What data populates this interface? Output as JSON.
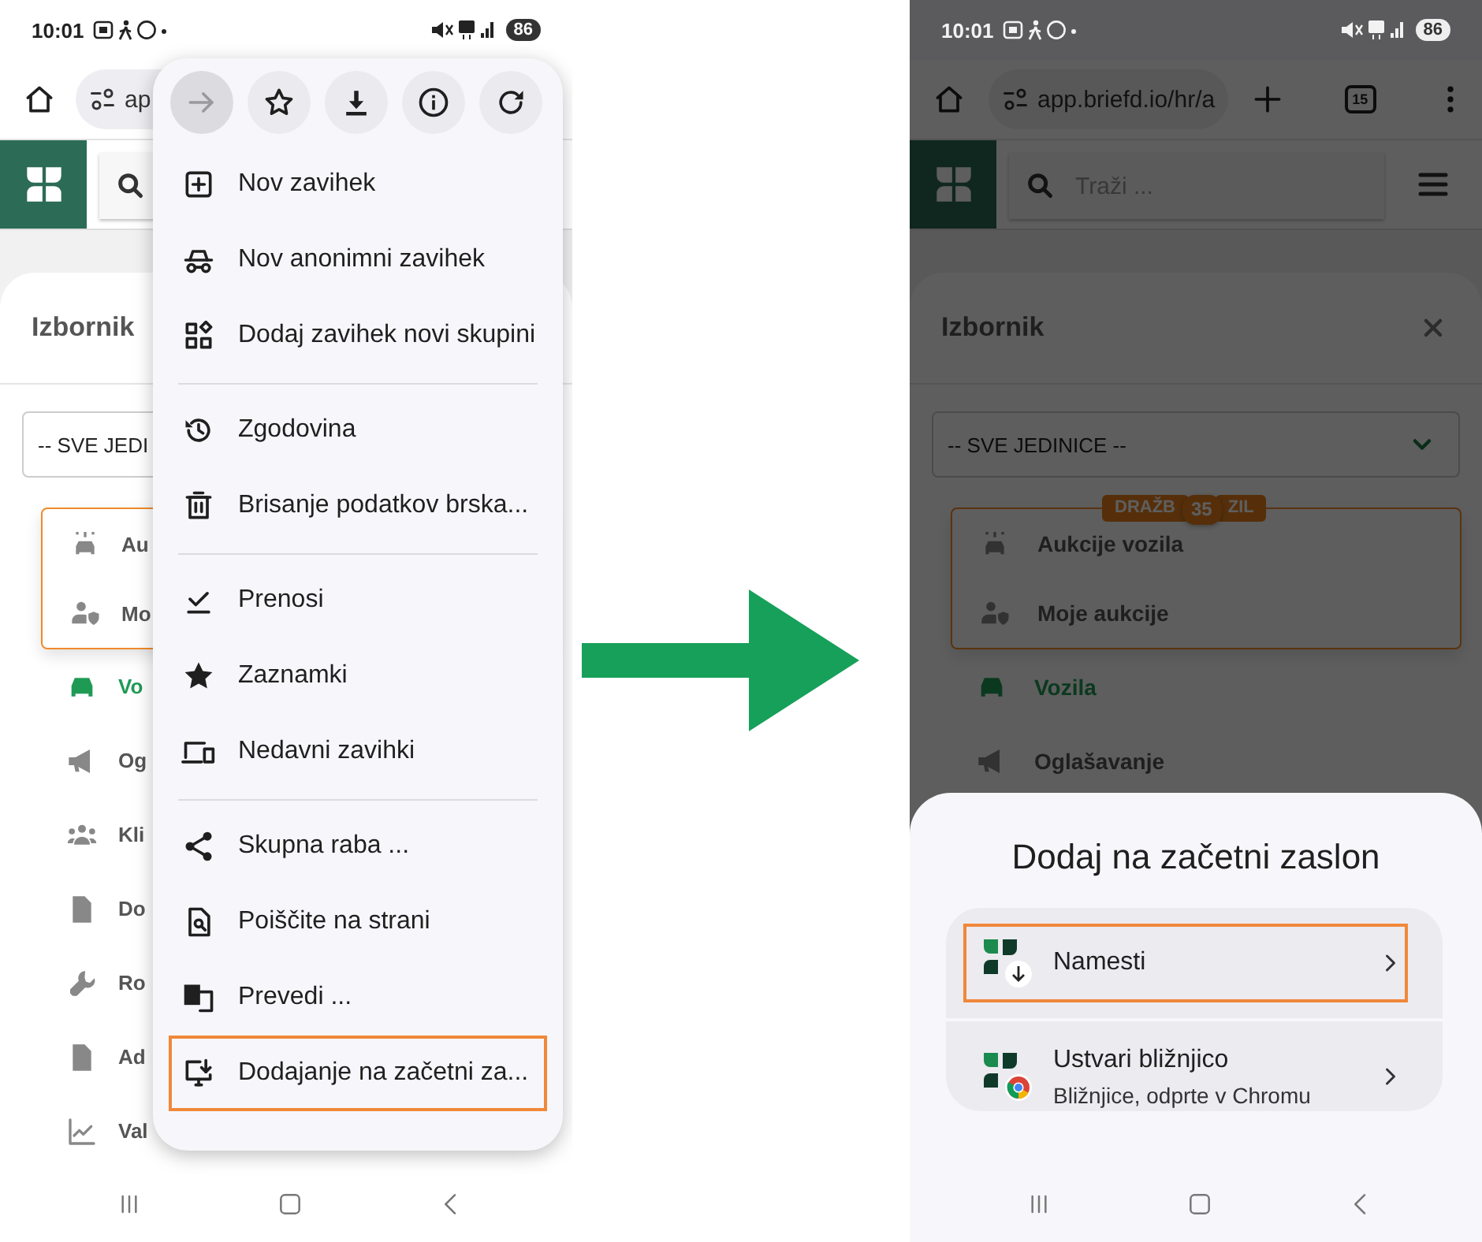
{
  "left_phone": {
    "status_bar": {
      "time": "10:01",
      "battery": "86"
    },
    "address_bar": {
      "url": "ap"
    },
    "page": {
      "title": "Izbornik",
      "unit_select": {
        "value": "-- SVE JEDI"
      },
      "auction_group": {
        "items": [
          {
            "label": "Au"
          },
          {
            "label": "Mo"
          }
        ]
      },
      "nav_items": [
        {
          "label": "Vo",
          "active": true
        },
        {
          "label": "Og",
          "active": false
        },
        {
          "label": "Kli",
          "active": false
        },
        {
          "label": "Do",
          "active": false
        },
        {
          "label": "Ro",
          "active": false
        },
        {
          "label": "Ad",
          "active": false
        },
        {
          "label": "Val",
          "active": false
        }
      ]
    }
  },
  "browser_menu": {
    "toolbar": [
      {
        "kind": "forward",
        "disabled": true
      },
      {
        "kind": "bookmark",
        "disabled": false
      },
      {
        "kind": "download",
        "disabled": false
      },
      {
        "kind": "info",
        "disabled": false
      },
      {
        "kind": "reload",
        "disabled": false
      }
    ],
    "groups": [
      {
        "items": [
          {
            "label": "Nov zavihek",
            "highlighted": false
          },
          {
            "label": "Nov anonimni zavihek",
            "highlighted": false
          },
          {
            "label": "Dodaj zavihek novi skupini",
            "highlighted": false
          }
        ]
      },
      {
        "items": [
          {
            "label": "Zgodovina",
            "highlighted": false
          },
          {
            "label": "Brisanje podatkov brska...",
            "highlighted": false
          }
        ]
      },
      {
        "items": [
          {
            "label": "Prenosi",
            "highlighted": false
          },
          {
            "label": "Zaznamki",
            "highlighted": false
          },
          {
            "label": "Nedavni zavihki",
            "highlighted": false
          }
        ]
      },
      {
        "items": [
          {
            "label": "Skupna raba ...",
            "highlighted": false
          },
          {
            "label": "Poiščite na strani",
            "highlighted": false
          },
          {
            "label": "Prevedi ...",
            "highlighted": false
          },
          {
            "label": "Dodajanje na začetni za...",
            "highlighted": true
          }
        ]
      }
    ]
  },
  "right_phone": {
    "status_bar": {
      "time": "10:01",
      "battery": "86"
    },
    "address_bar": {
      "url": "app.briefd.io/hr/a",
      "tab_count": "15"
    },
    "search": {
      "placeholder": "Traži ..."
    },
    "page": {
      "title": "Izbornik",
      "unit_select": {
        "value": "-- SVE JEDINICE --"
      },
      "auction_group": {
        "label_start": "DRAŽB",
        "badge": "35",
        "label_end": "ZIL",
        "items": [
          {
            "label": "Aukcije vozila"
          },
          {
            "label": "Moje aukcije"
          }
        ]
      },
      "nav_items": [
        {
          "label": "Vozila",
          "active": true
        },
        {
          "label": "Oglašavanje",
          "active": false
        }
      ]
    }
  },
  "install_sheet": {
    "title": "Dodaj na začetni zaslon",
    "options": [
      {
        "kind": "install",
        "title": "Namesti",
        "highlighted": true
      },
      {
        "kind": "shortcut",
        "title": "Ustvari bližnjico",
        "subtitle": "Bližnjice, odprte v Chromu",
        "highlighted": false
      }
    ]
  }
}
